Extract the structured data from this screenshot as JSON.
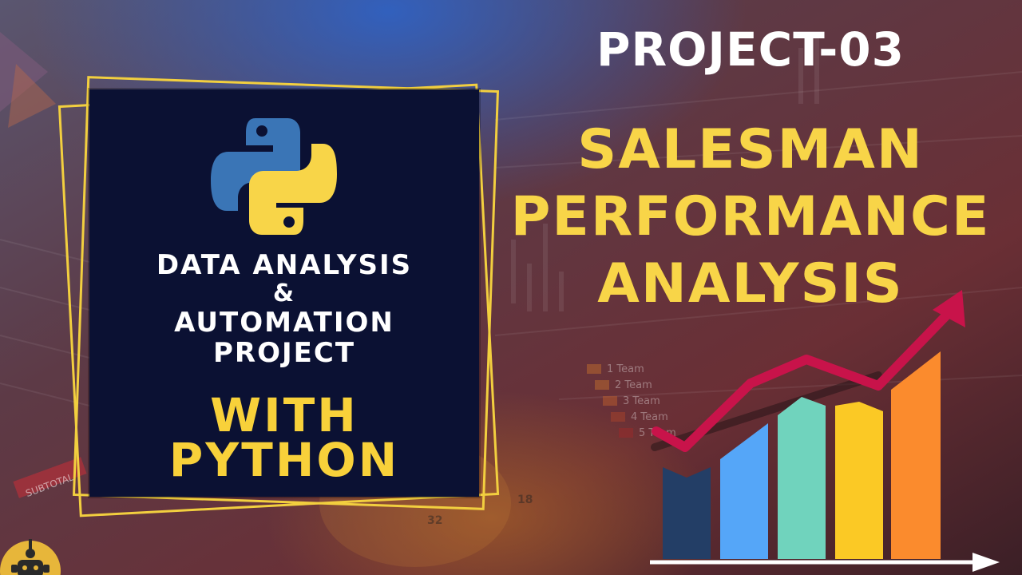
{
  "card": {
    "line1": "DATA ANALYSIS",
    "line2": "&",
    "line3": "AUTOMATION",
    "line4": "PROJECT",
    "yellow1": "WITH",
    "yellow2": "PYTHON"
  },
  "headline": {
    "project": "PROJECT-03",
    "title1": "SALESMAN",
    "title2": "PERFORMANCE",
    "title3": "ANALYSIS"
  },
  "background_labels": [
    "1 Team",
    "2 Team",
    "3 Team",
    "4 Team",
    "5 Team",
    "SUBTOTAL",
    "32",
    "18"
  ],
  "colors": {
    "accent_yellow": "#f8d548",
    "card_bg": "#0b1133",
    "python_blue": "#3a75b6",
    "python_yellow": "#f8d548",
    "arrow_red": "#c8134a",
    "bar_navy": "#233e66",
    "bar_blue": "#55a6f8",
    "bar_teal": "#70d3bd",
    "bar_yellow": "#fbc925",
    "bar_orange": "#fb8b2d"
  },
  "icons": [
    "python-logo-icon",
    "trend-arrow-icon",
    "axis-arrow-icon",
    "robot-mascot-icon"
  ]
}
